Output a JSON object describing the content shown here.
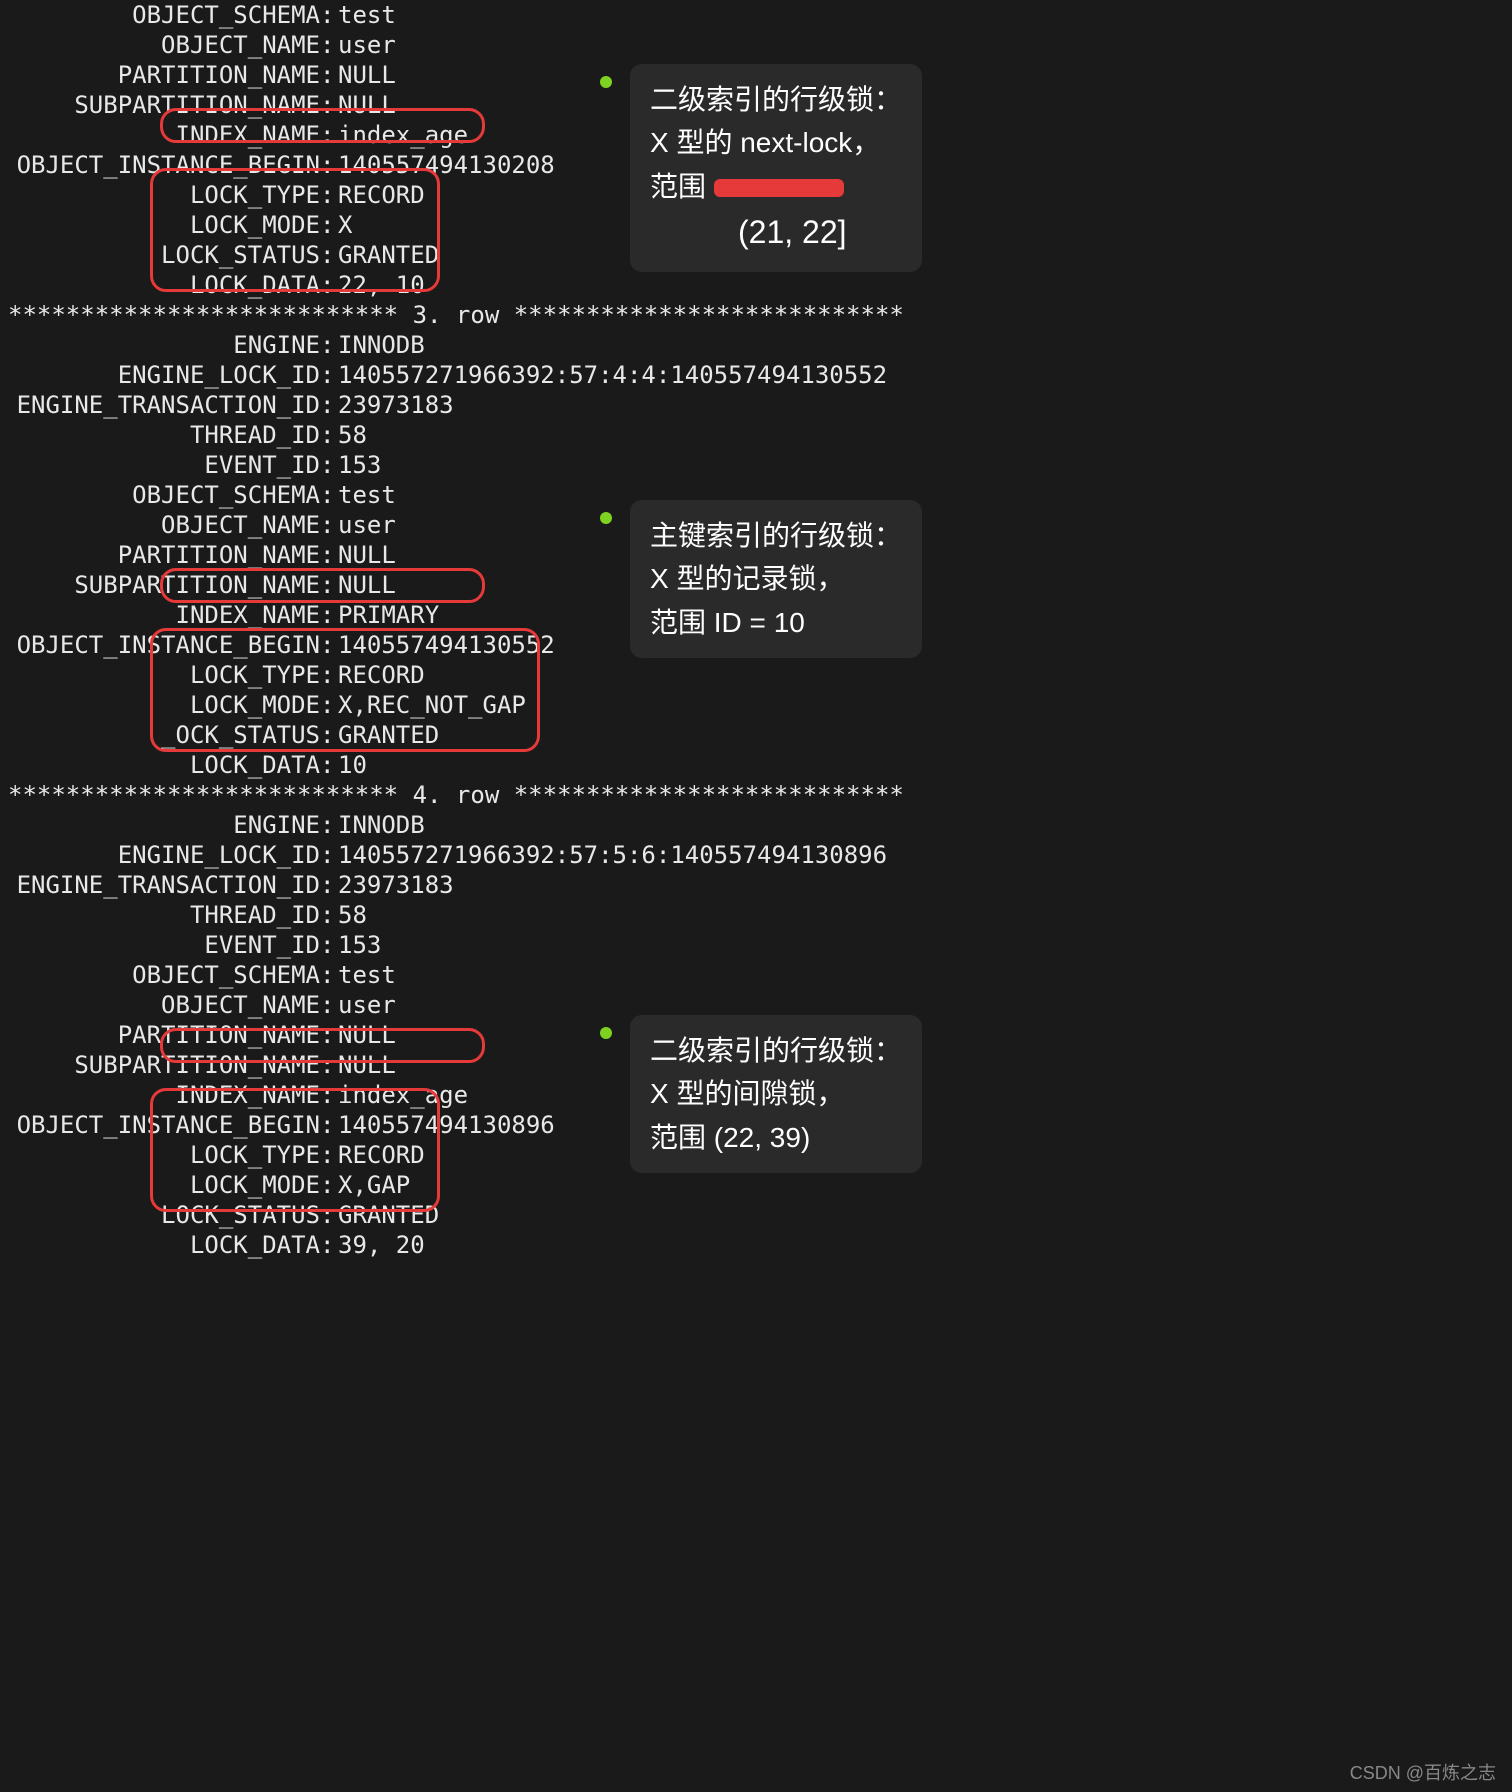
{
  "section1": {
    "rows": [
      {
        "k": "OBJECT_SCHEMA",
        "v": "test"
      },
      {
        "k": "OBJECT_NAME",
        "v": "user"
      },
      {
        "k": "PARTITION_NAME",
        "v": "NULL"
      },
      {
        "k": "SUBPARTITION_NAME",
        "v": "NULL"
      },
      {
        "k": "INDEX_NAME",
        "v": "index_age"
      },
      {
        "k": "OBJECT_INSTANCE_BEGIN",
        "v": "140557494130208"
      },
      {
        "k": "LOCK_TYPE",
        "v": "RECORD"
      },
      {
        "k": "LOCK_MODE",
        "v": "X"
      },
      {
        "k": "LOCK_STATUS",
        "v": "GRANTED"
      },
      {
        "k": "LOCK_DATA",
        "v": "22, 10"
      }
    ]
  },
  "separator3": "*************************** 3. row ***************************",
  "section2": {
    "rows": [
      {
        "k": "ENGINE",
        "v": "INNODB"
      },
      {
        "k": "ENGINE_LOCK_ID",
        "v": "140557271966392:57:4:4:140557494130552"
      },
      {
        "k": "ENGINE_TRANSACTION_ID",
        "v": "23973183"
      },
      {
        "k": "THREAD_ID",
        "v": "58"
      },
      {
        "k": "EVENT_ID",
        "v": "153"
      },
      {
        "k": "OBJECT_SCHEMA",
        "v": "test"
      },
      {
        "k": "OBJECT_NAME",
        "v": "user"
      },
      {
        "k": "PARTITION_NAME",
        "v": "NULL"
      },
      {
        "k": "SUBPARTITION_NAME",
        "v": "NULL"
      },
      {
        "k": "INDEX_NAME",
        "v": "PRIMARY"
      },
      {
        "k": "OBJECT_INSTANCE_BEGIN",
        "v": "140557494130552"
      },
      {
        "k": "LOCK_TYPE",
        "v": "RECORD"
      },
      {
        "k": "LOCK_MODE",
        "v": "X,REC_NOT_GAP"
      },
      {
        "k": "_OCK_STATUS",
        "v": "GRANTED"
      },
      {
        "k": "LOCK_DATA",
        "v": "10"
      }
    ]
  },
  "separator4": "*************************** 4. row ***************************",
  "section3": {
    "rows": [
      {
        "k": "ENGINE",
        "v": "INNODB"
      },
      {
        "k": "ENGINE_LOCK_ID",
        "v": "140557271966392:57:5:6:140557494130896"
      },
      {
        "k": "ENGINE_TRANSACTION_ID",
        "v": "23973183"
      },
      {
        "k": "THREAD_ID",
        "v": "58"
      },
      {
        "k": "EVENT_ID",
        "v": "153"
      },
      {
        "k": "OBJECT_SCHEMA",
        "v": "test"
      },
      {
        "k": "OBJECT_NAME",
        "v": "user"
      },
      {
        "k": "PARTITION_NAME",
        "v": "NULL"
      },
      {
        "k": "SUBPARTITION_NAME",
        "v": "NULL"
      },
      {
        "k": "INDEX_NAME",
        "v": "index_age"
      },
      {
        "k": "OBJECT_INSTANCE_BEGIN",
        "v": "140557494130896"
      },
      {
        "k": "LOCK_TYPE",
        "v": "RECORD"
      },
      {
        "k": "LOCK_MODE",
        "v": "X,GAP"
      },
      {
        "k": "LOCK_STATUS",
        "v": "GRANTED"
      },
      {
        "k": "LOCK_DATA",
        "v": "39, 20"
      }
    ]
  },
  "annotations": {
    "a1": {
      "line1": "二级索引的行级锁：",
      "line2": "X 型的 next-lock，",
      "line3a": "范围 ",
      "line4": "(21, 22]"
    },
    "a2": {
      "line1": "主键索引的行级锁：",
      "line2": "X 型的记录锁，",
      "line3": "范围 ID = 10"
    },
    "a3": {
      "line1": "二级索引的行级锁：",
      "line2": "X 型的间隙锁，",
      "line3": "范围 (22, 39)"
    }
  },
  "watermark": "CSDN @百炼之志"
}
